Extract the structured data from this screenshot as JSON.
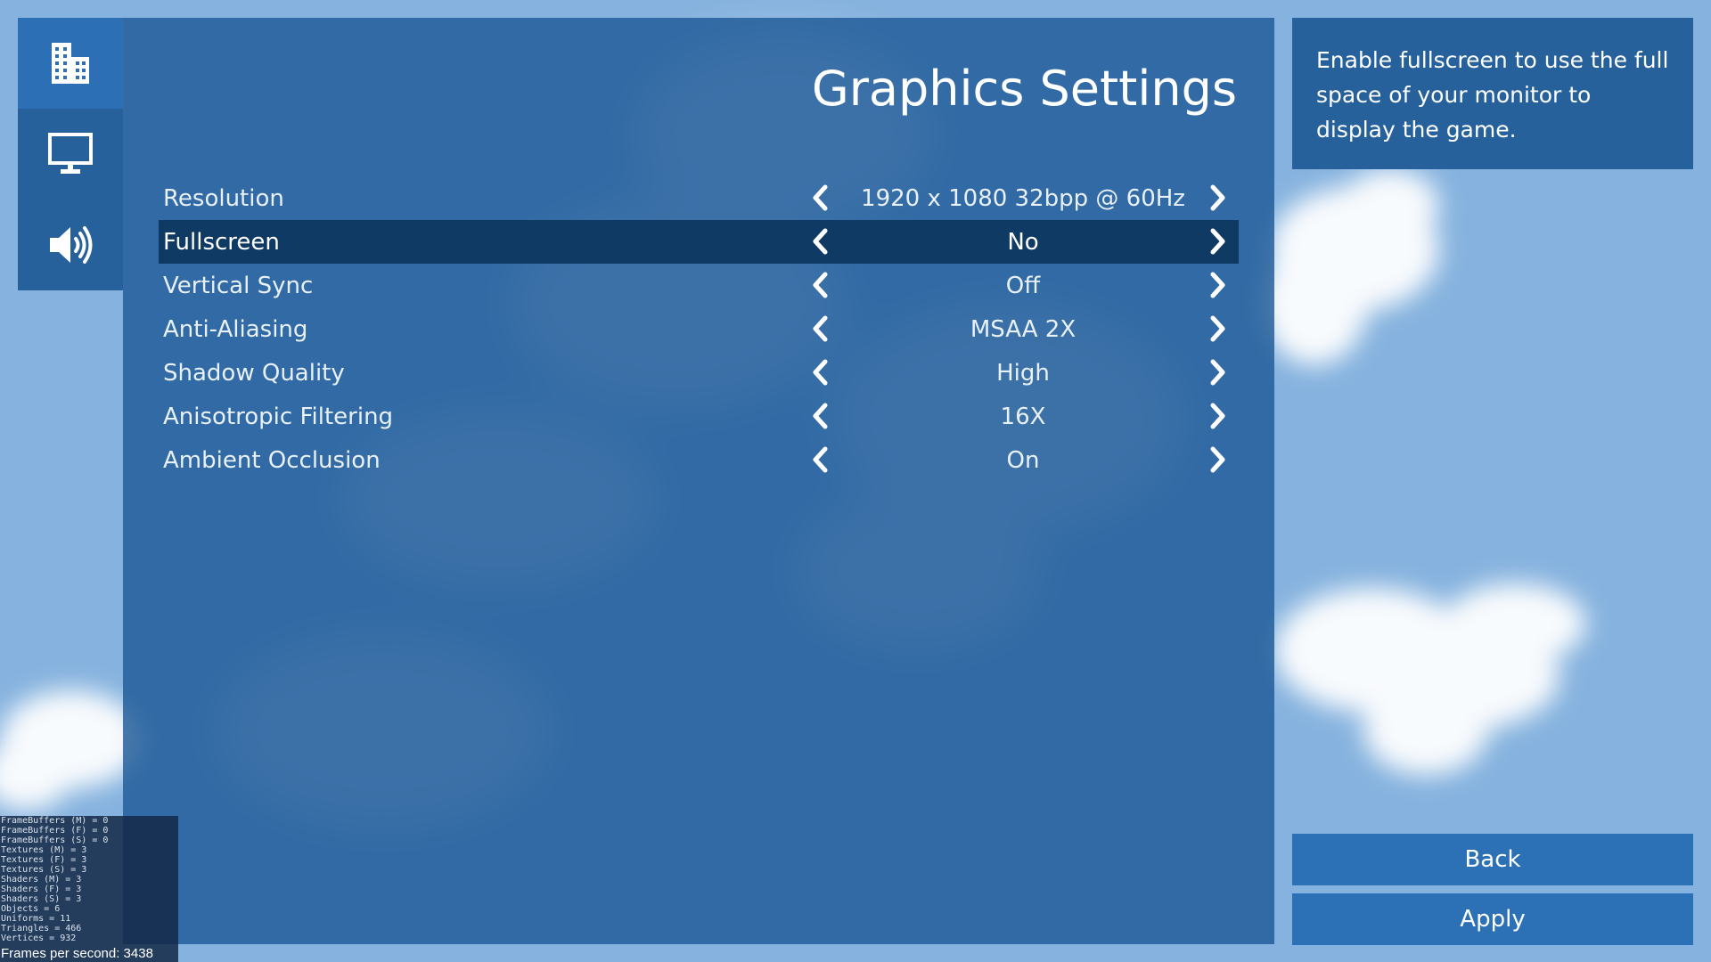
{
  "colors": {
    "sky": "#85b2de",
    "panel": "#1c5896",
    "selected_row": "#0f3a64",
    "button": "#2c70b6",
    "text": "#ffffff"
  },
  "sidebar": {
    "items": [
      {
        "icon": "city-buildings-icon",
        "active": true
      },
      {
        "icon": "monitor-icon",
        "active": false
      },
      {
        "icon": "speaker-volume-icon",
        "active": false
      }
    ]
  },
  "main": {
    "title": "Graphics Settings",
    "settings": [
      {
        "label": "Resolution",
        "value": "1920 x 1080 32bpp @ 60Hz",
        "selected": false
      },
      {
        "label": "Fullscreen",
        "value": "No",
        "selected": true
      },
      {
        "label": "Vertical Sync",
        "value": "Off",
        "selected": false
      },
      {
        "label": "Anti-Aliasing",
        "value": "MSAA 2X",
        "selected": false
      },
      {
        "label": "Shadow Quality",
        "value": "High",
        "selected": false
      },
      {
        "label": "Anisotropic Filtering",
        "value": "16X",
        "selected": false
      },
      {
        "label": "Ambient Occlusion",
        "value": "On",
        "selected": false
      }
    ]
  },
  "help": {
    "text": "Enable fullscreen to use the full space of your monitor to display the game."
  },
  "buttons": {
    "back": "Back",
    "apply": "Apply"
  },
  "debug": {
    "lines": [
      "FrameBuffers (M) = 0",
      "FrameBuffers (F) = 0",
      "FrameBuffers (S) = 0",
      "Textures (M) = 3",
      "Textures (F) = 3",
      "Textures (S) = 3",
      "Shaders (M) = 3",
      "Shaders (F) = 3",
      "Shaders (S) = 3",
      "Objects = 6",
      "Uniforms = 11",
      "Triangles = 466",
      "Vertices = 932"
    ],
    "fps": "Frames per second: 3438"
  }
}
